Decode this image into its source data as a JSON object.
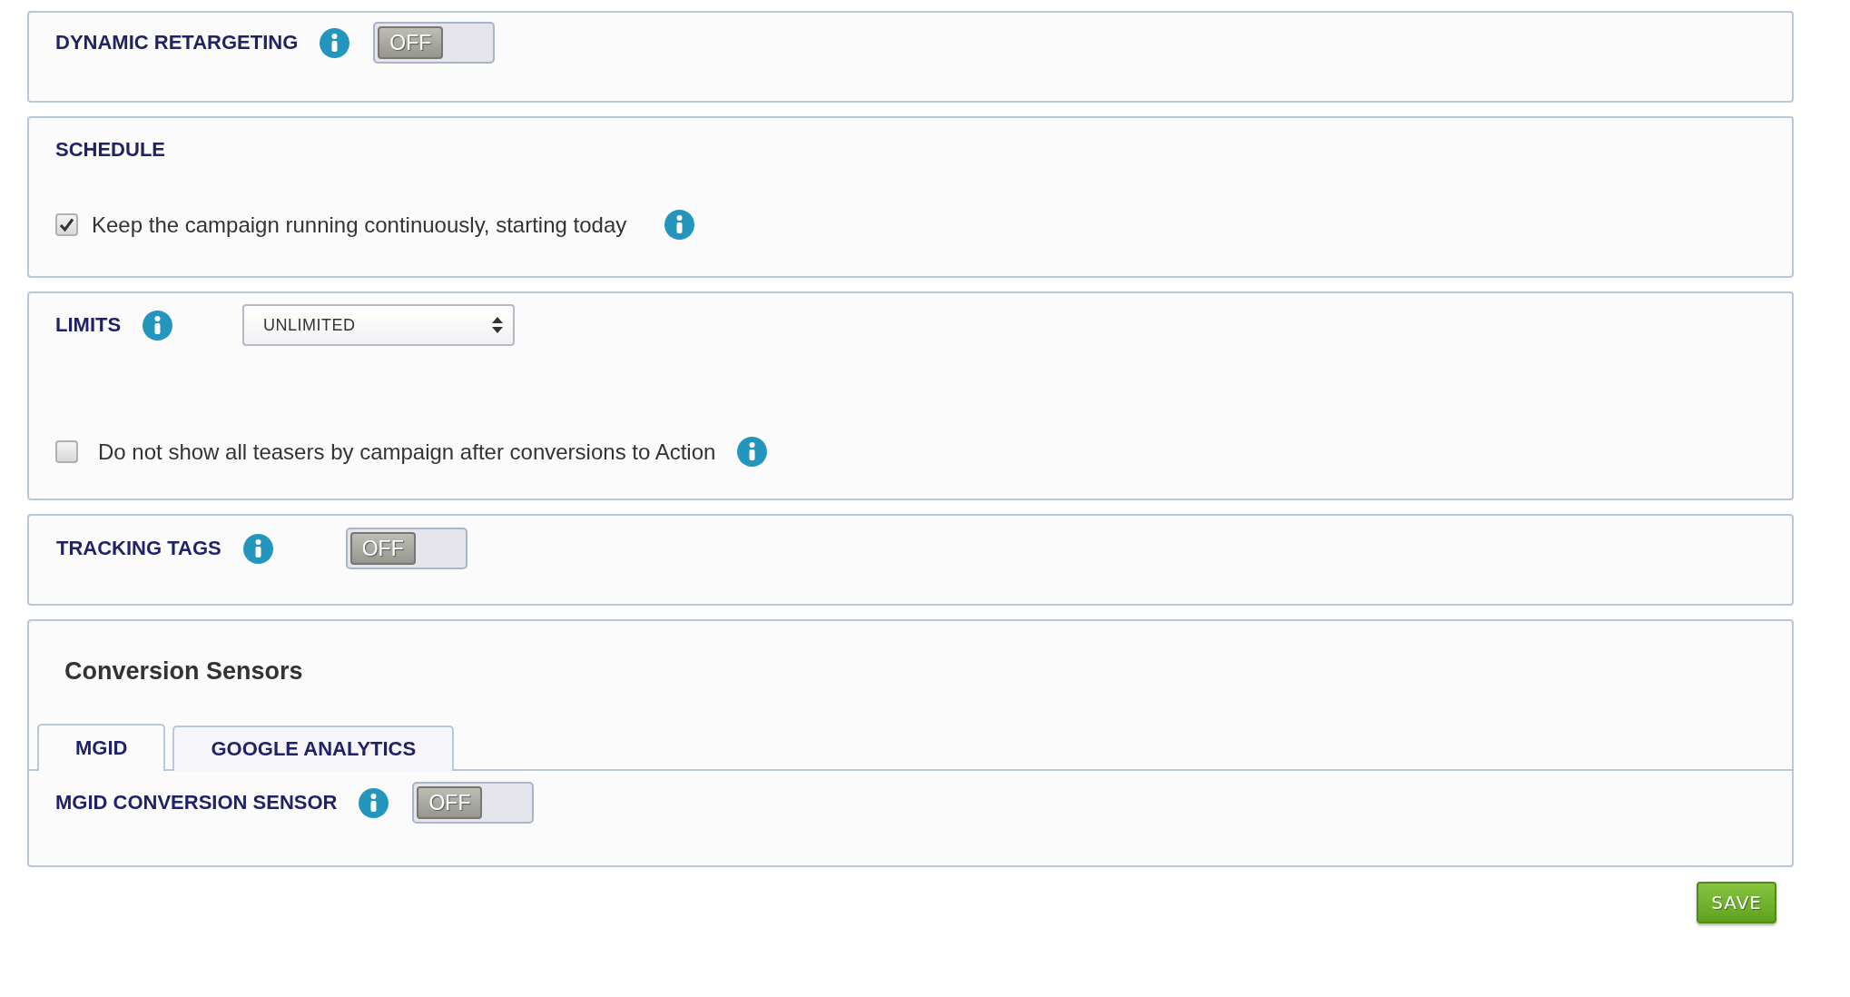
{
  "sections": [
    {
      "kind": "toggle",
      "title": "DYNAMIC RETARGETING",
      "switch": {
        "label": "OFF",
        "on": false
      }
    },
    {
      "kind": "schedule",
      "title": "SCHEDULE",
      "options": [
        {
          "label": "Keep the campaign running continuously, starting today",
          "checked": true
        }
      ]
    },
    {
      "kind": "limits",
      "title": "LIMITS",
      "select": {
        "value": "UNLIMITED"
      },
      "options": [
        {
          "label": "Do not show all teasers by campaign after conversions to Action",
          "checked": false
        }
      ]
    },
    {
      "kind": "toggle",
      "title": "TRACKING TAGS",
      "switch": {
        "label": "OFF",
        "on": false
      }
    },
    {
      "kind": "tabs",
      "title": "Conversion Sensors",
      "tabs": [
        {
          "label": "MGID",
          "selected": true
        },
        {
          "label": "GOOGLE ANALYTICS",
          "selected": false
        }
      ],
      "panel": {
        "title": "MGID CONVERSION SENSOR",
        "switch": {
          "label": "OFF",
          "on": false
        }
      }
    }
  ],
  "save_button": {
    "label": "SAVE"
  }
}
